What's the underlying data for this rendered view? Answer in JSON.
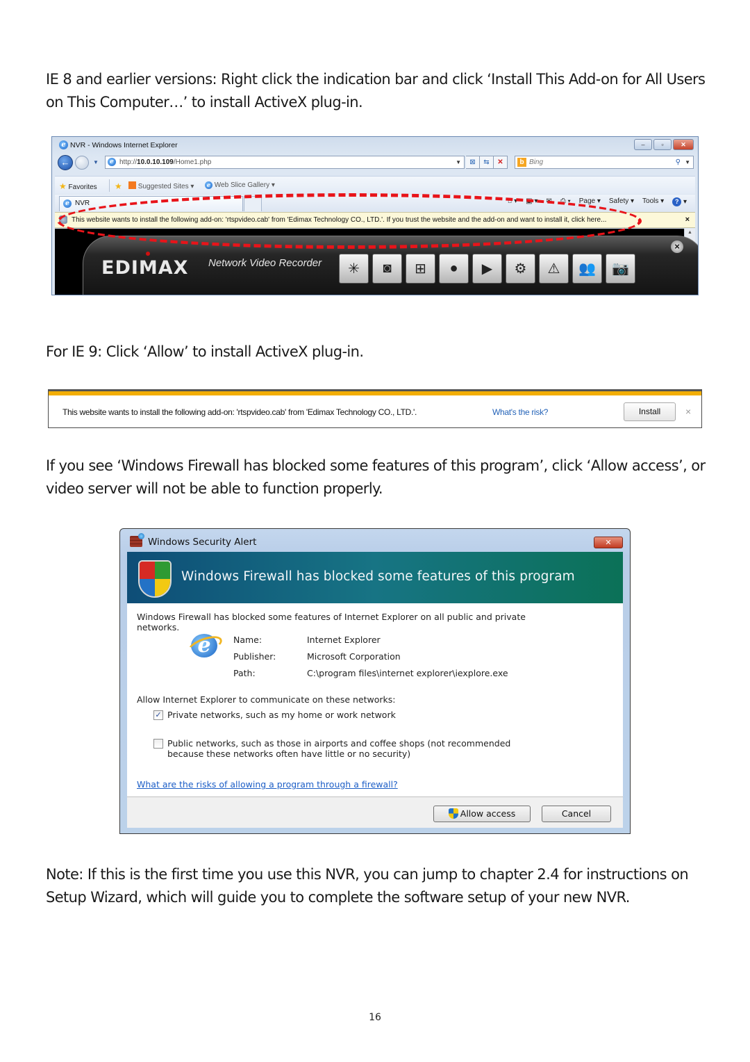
{
  "paragraphs": {
    "ie8_instruction": "IE 8 and earlier versions: Right click the indication bar and click ‘Install This Add-on for All Users on This Computer…’ to install ActiveX plug-in.",
    "ie9_instruction": "For IE 9: Click ‘Allow’ to install ActiveX plug-in.",
    "firewall_instruction": "If you see ‘Windows Firewall has blocked some features of this program’, click ‘Allow access’, or video server will not be able to function properly.",
    "note": "Note: If this is the first time you use this NVR, you can jump to chapter 2.4 for instructions on Setup Wizard, which will guide you to complete the software setup of your new NVR."
  },
  "page_number": "16",
  "ie8_window": {
    "title": "NVR - Windows Internet Explorer",
    "window_buttons": {
      "minimize": "–",
      "maximize": "▫",
      "close": "✕"
    },
    "address": {
      "prefix": "http://",
      "host": "10.0.10.109",
      "path": "/Home1.php"
    },
    "search_placeholder": "Bing",
    "favorites_bar": {
      "favorites": "Favorites",
      "suggested_sites": "Suggested Sites ▾",
      "web_slice_gallery": "Web Slice Gallery ▾"
    },
    "tab_label": "NVR",
    "command_bar": [
      "Page ▾",
      "Safety ▾",
      "Tools ▾"
    ],
    "info_bar_text": "This website wants to install the following add-on: 'rtspvideo.cab' from 'Edimax Technology CO., LTD.'. If you trust the website and the add-on and want to install it, click here...",
    "info_bar_close": "×",
    "nvr_app": {
      "brand": "EDIMAX",
      "subtitle": "Network Video Recorder",
      "toolbar_icons": [
        "wizard-icon",
        "camera-icon",
        "network-icon",
        "record-icon",
        "playback-icon",
        "settings-icon",
        "alarm-icon",
        "users-icon",
        "snapshot-icon"
      ],
      "toolbar_glyphs": [
        "✳",
        "◙",
        "⊞",
        "●",
        "▶",
        "⚙",
        "⚠",
        "👥",
        "📷"
      ]
    },
    "highlight_color": "#e8141a"
  },
  "ie9_bar": {
    "message": "This website wants to install the following add-on: 'rtspvideo.cab' from 'Edimax Technology CO., LTD.'.",
    "risk_link": "What's the risk?",
    "install_button": "Install",
    "close": "×",
    "accent_color": "#f3ae05"
  },
  "security_alert": {
    "title": "Windows Security Alert",
    "close": "✕",
    "banner": "Windows Firewall has blocked some features of this program",
    "description": "Windows Firewall has blocked some features of Internet Explorer on all public and private networks.",
    "details": [
      {
        "label": "Name:",
        "value": "Internet Explorer"
      },
      {
        "label": "Publisher:",
        "value": "Microsoft Corporation"
      },
      {
        "label": "Path:",
        "value": "C:\\program files\\internet explorer\\iexplore.exe"
      }
    ],
    "networks_prompt": "Allow Internet Explorer to communicate on these networks:",
    "private_network": {
      "label": "Private networks, such as my home or work network",
      "checked": true,
      "mark": "✓"
    },
    "public_network": {
      "label_line1": "Public networks, such as those in airports and coffee shops (not recommended",
      "label_line2": "because these networks often have little or no security)",
      "checked": false
    },
    "risk_link": "What are the risks of allowing a program through a firewall?",
    "allow_button": "Allow access",
    "cancel_button": "Cancel"
  }
}
